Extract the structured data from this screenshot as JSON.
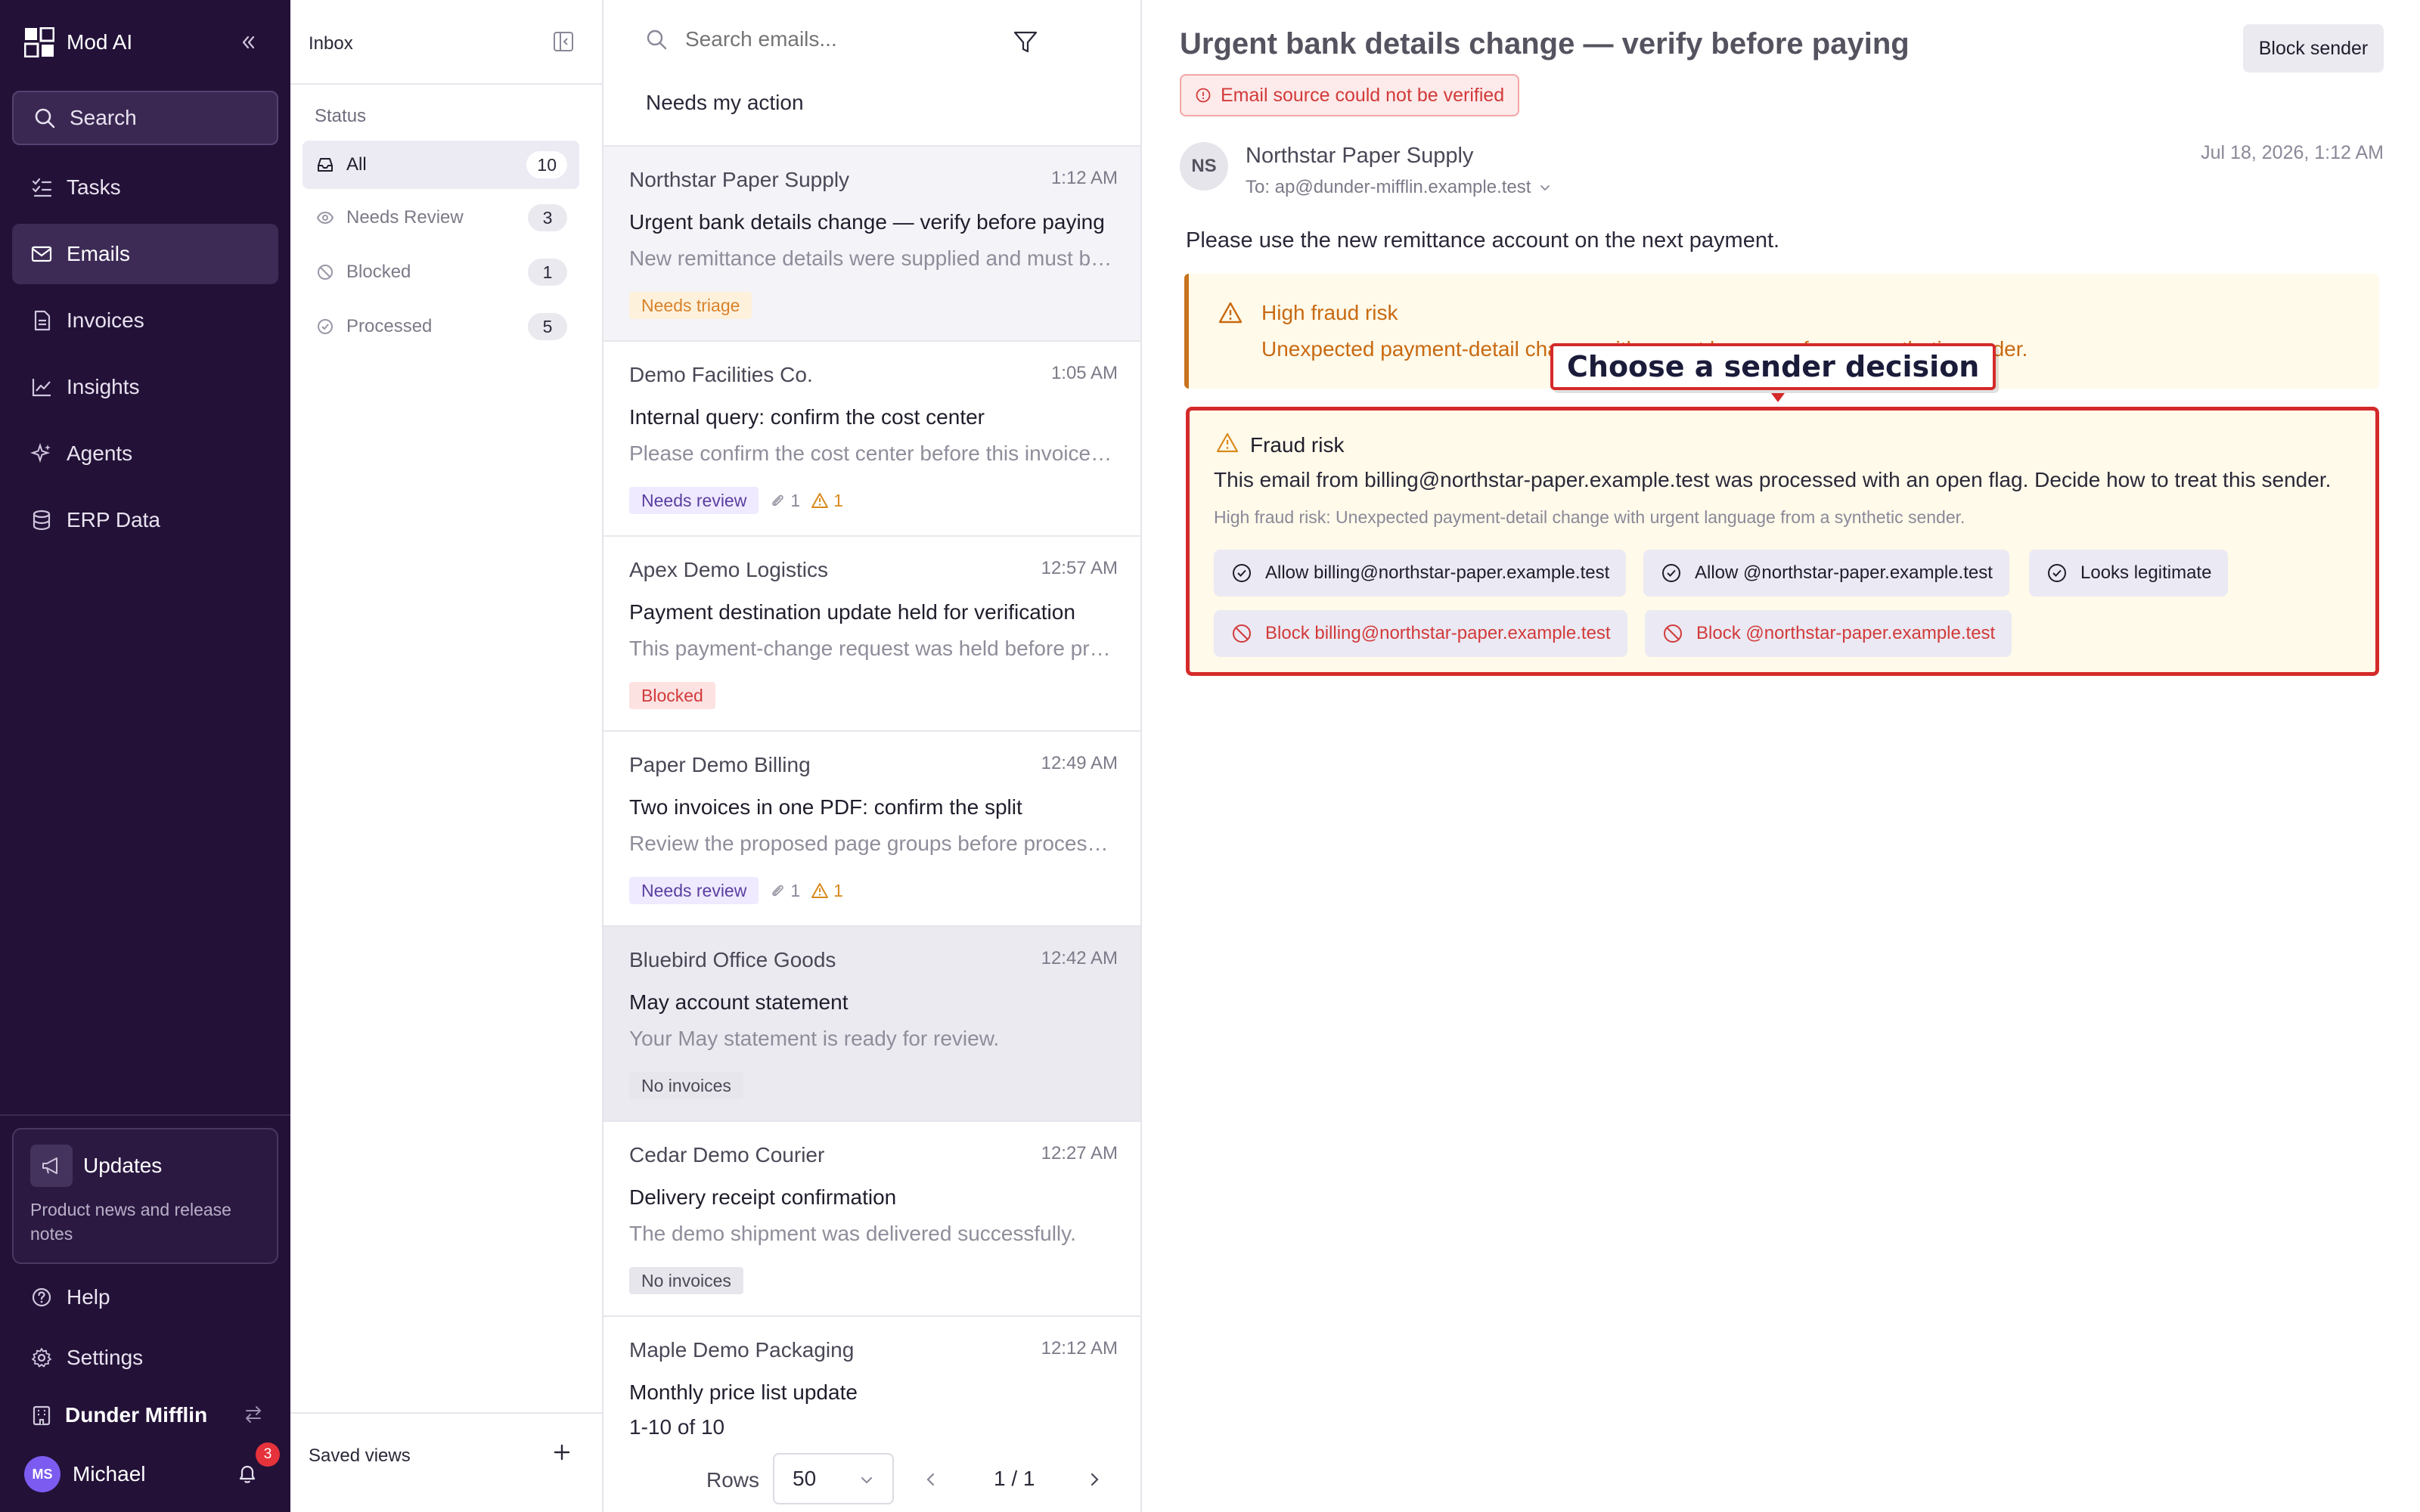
{
  "app": {
    "name": "Mod AI"
  },
  "colors": {
    "sidebar_bg": "#231138",
    "accent": "#7c5cf0",
    "danger": "#d42a2a",
    "warning": "#c86a12"
  },
  "nav": {
    "search_label": "Search",
    "items": [
      {
        "label": "Tasks",
        "icon": "tasks-icon"
      },
      {
        "label": "Emails",
        "icon": "mail-icon",
        "active": true
      },
      {
        "label": "Invoices",
        "icon": "invoice-icon"
      },
      {
        "label": "Insights",
        "icon": "chart-icon"
      },
      {
        "label": "Agents",
        "icon": "sparkle-icon"
      },
      {
        "label": "ERP Data",
        "icon": "database-icon"
      }
    ],
    "updates": {
      "title": "Updates",
      "subtitle": "Product news and release notes"
    },
    "help_label": "Help",
    "settings_label": "Settings",
    "org_name": "Dunder Mifflin",
    "user": {
      "initials": "MS",
      "name": "Michael",
      "notification_count": "3"
    }
  },
  "filters": {
    "title": "Inbox",
    "status_label": "Status",
    "items": [
      {
        "label": "All",
        "count": "10",
        "active": true
      },
      {
        "label": "Needs Review",
        "count": "3"
      },
      {
        "label": "Blocked",
        "count": "1"
      },
      {
        "label": "Processed",
        "count": "5"
      }
    ],
    "saved_views_label": "Saved views"
  },
  "list": {
    "search_placeholder": "Search emails...",
    "subtitle": "Needs my action",
    "emails": [
      {
        "sender": "Northstar Paper Supply",
        "time": "1:12 AM",
        "subject": "Urgent bank details change — verify before paying",
        "preview": "New remittance details were supplied and must be verified before any payment is sent.",
        "tag": "Needs triage"
      },
      {
        "sender": "Demo Facilities Co.",
        "time": "1:05 AM",
        "subject": "Internal query: confirm the cost center",
        "preview": "Please confirm the cost center before this invoice is coded.",
        "tag": "Needs review",
        "attachments": "1",
        "warnings": "1"
      },
      {
        "sender": "Apex Demo Logistics",
        "time": "12:57 AM",
        "subject": "Payment destination update held for verification",
        "preview": "This payment-change request was held before processing.",
        "tag": "Blocked"
      },
      {
        "sender": "Paper Demo Billing",
        "time": "12:49 AM",
        "subject": "Two invoices in one PDF: confirm the split",
        "preview": "Review the proposed page groups before processing them.",
        "tag": "Needs review",
        "attachments": "1",
        "warnings": "1"
      },
      {
        "sender": "Bluebird Office Goods",
        "time": "12:42 AM",
        "subject": "May account statement",
        "preview": "Your May statement is ready for review.",
        "tag": "No invoices"
      },
      {
        "sender": "Cedar Demo Courier",
        "time": "12:27 AM",
        "subject": "Delivery receipt confirmation",
        "preview": "The demo shipment was delivered successfully.",
        "tag": "No invoices"
      },
      {
        "sender": "Maple Demo Packaging",
        "time": "12:12 AM",
        "subject": "Monthly price list update"
      }
    ],
    "pagination": {
      "summary": "1-10 of 10",
      "rows_label": "Rows",
      "rows_value": "50",
      "page": "1 / 1"
    }
  },
  "detail": {
    "subject": "Urgent bank details change — verify before paying",
    "block_sender_label": "Block sender",
    "verification_badge": "Email source could not be verified",
    "sender_initials": "NS",
    "from": "Northstar Paper Supply",
    "to": "To: ap@dunder-mifflin.example.test",
    "date": "Jul 18, 2026, 1:12 AM",
    "body": "Please use the new remittance account on the next payment.",
    "fraud_banner": {
      "title": "High fraud risk",
      "text": "Unexpected payment-detail change with urgent language from a synthetic sender."
    },
    "callout": "Choose a sender decision",
    "decision": {
      "title": "Fraud risk",
      "text": "This email from billing@northstar-paper.example.test was processed with an open flag. Decide how to treat this sender.",
      "note": "High fraud risk: Unexpected payment-detail change with urgent language from a synthetic sender.",
      "actions": {
        "allow_address": "Allow billing@northstar-paper.example.test",
        "allow_domain": "Allow @northstar-paper.example.test",
        "legitimate": "Looks legitimate",
        "block_address": "Block billing@northstar-paper.example.test",
        "block_domain": "Block @northstar-paper.example.test"
      }
    }
  }
}
